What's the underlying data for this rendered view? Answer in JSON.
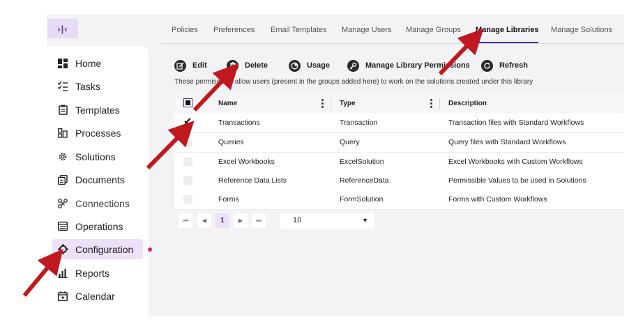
{
  "sidebar": {
    "collapse_glyph": "›|‹",
    "items": [
      {
        "label": "Home",
        "icon": "dashboard-icon"
      },
      {
        "label": "Tasks",
        "icon": "checklist-icon"
      },
      {
        "label": "Templates",
        "icon": "clipboard-icon"
      },
      {
        "label": "Processes",
        "icon": "process-icon"
      },
      {
        "label": "Solutions",
        "icon": "gear-cog-icon"
      },
      {
        "label": "Documents",
        "icon": "documents-icon"
      },
      {
        "label": "Connections",
        "icon": "connections-icon"
      },
      {
        "label": "Operations",
        "icon": "list-window-icon"
      },
      {
        "label": "Configuration",
        "icon": "settings-icon"
      },
      {
        "label": "Reports",
        "icon": "bar-chart-icon"
      },
      {
        "label": "Calendar",
        "icon": "calendar-icon"
      }
    ],
    "active_index": 8
  },
  "tabs": [
    "Policies",
    "Preferences",
    "Email Templates",
    "Manage Users",
    "Manage Groups",
    "Manage Libraries",
    "Manage Solutions"
  ],
  "active_tab": "Manage Libraries",
  "toolbar": {
    "edit": "Edit",
    "delete": "Delete",
    "usage": "Usage",
    "permissions": "Manage Library Permissions",
    "refresh": "Refresh"
  },
  "info_text": "These permissions allow users (present in the groups added here) to work on the solutions created under this library",
  "grid": {
    "columns": [
      "Name",
      "Type",
      "Description"
    ],
    "rows": [
      {
        "name": "Transactions",
        "type": "Transaction",
        "description": "Transaction files with Standard Workflows",
        "checked": true
      },
      {
        "name": "Queries",
        "type": "Query",
        "description": "Query files with Standard Workflows",
        "checked": false
      },
      {
        "name": "Excel Workbooks",
        "type": "ExcelSolution",
        "description": "Excel Workbooks with Custom Workflows",
        "checked": false
      },
      {
        "name": "Reference Data Lists",
        "type": "ReferenceData",
        "description": "Permissible Values to be used in Solutions",
        "checked": false
      },
      {
        "name": "Forms",
        "type": "FormSolution",
        "description": "Forms with Custom Workflows",
        "checked": false
      }
    ]
  },
  "pager": {
    "current_page": "1",
    "page_size": "10",
    "first": "⏮",
    "prev": "◀",
    "next": "▶",
    "last": "⏭"
  },
  "colors": {
    "accent": "#4b2b8a",
    "active_bg": "#ece1f8",
    "annotation_arrow": "#c0181e",
    "notification_dot": "#d4267a"
  }
}
